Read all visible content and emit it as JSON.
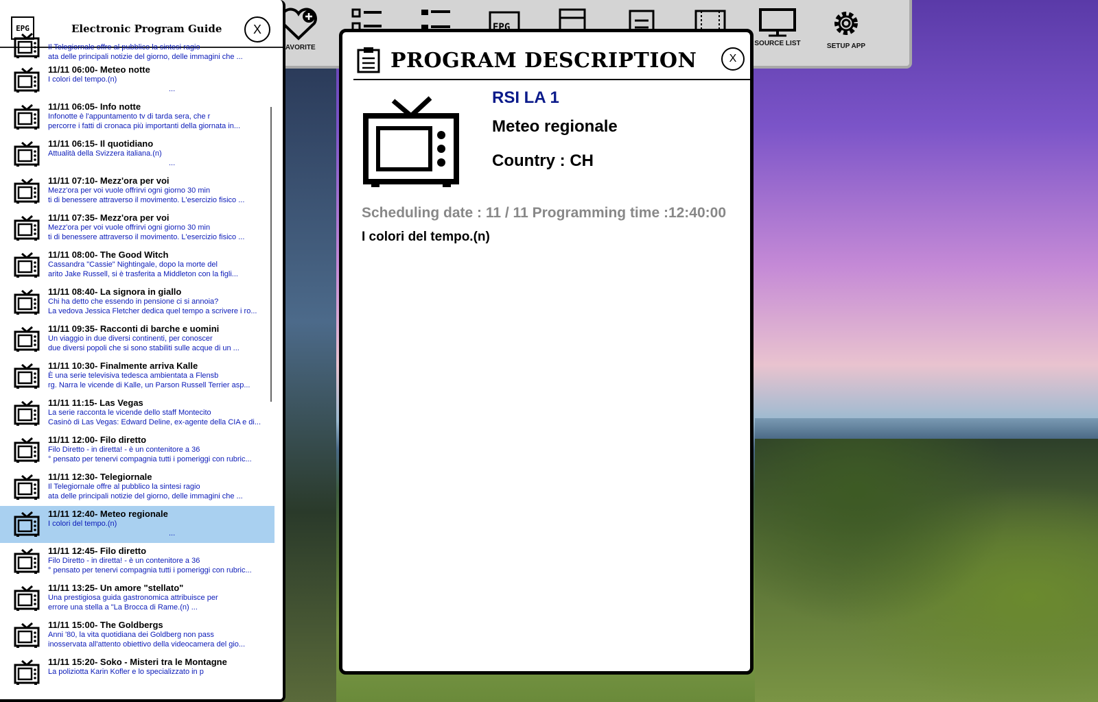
{
  "toolbar": {
    "items": [
      {
        "label": "FAVORITE",
        "icon": "heart-plus-icon"
      },
      {
        "label": "",
        "icon": "grid-list-icon"
      },
      {
        "label": "",
        "icon": "list-icon"
      },
      {
        "label": "",
        "icon": "epg-icon"
      },
      {
        "label": "",
        "icon": "record-icon"
      },
      {
        "label": "",
        "icon": "clipboard-icon"
      },
      {
        "label": "",
        "icon": "film-icon"
      },
      {
        "label": "SOURCE LIST",
        "icon": "monitor-icon"
      },
      {
        "label": "SETUP APP",
        "icon": "gear-icon"
      }
    ]
  },
  "epg": {
    "logo_text": "EPG",
    "title": "Electronic Program Guide",
    "close_label": "X",
    "programs": [
      {
        "title": "",
        "desc1": "Il Telegiornale offre al pubblico la sintesi ragio",
        "desc2": "ata delle principali notizie del giorno, delle immagini che ..."
      },
      {
        "title": "11/11 06:00- Meteo notte",
        "desc1": "I colori del tempo.(n)",
        "desc2": "..."
      },
      {
        "title": "11/11 06:05- Info notte",
        "desc1": "Infonotte è l'appuntamento tv di tarda sera, che r",
        "desc2": "percorre i fatti di cronaca più importanti della giornata in..."
      },
      {
        "title": "11/11 06:15- Il quotidiano",
        "desc1": "Attualità della Svizzera italiana.(n)",
        "desc2": "..."
      },
      {
        "title": "11/11 07:10- Mezz'ora per voi",
        "desc1": "Mezz'ora per voi vuole offrirvi ogni giorno 30 min",
        "desc2": "ti di benessere attraverso il movimento. L'esercizio fisico ..."
      },
      {
        "title": "11/11 07:35- Mezz'ora per voi",
        "desc1": "Mezz'ora per voi vuole offrirvi ogni giorno 30 min",
        "desc2": "ti di benessere attraverso il movimento. L'esercizio fisico ..."
      },
      {
        "title": "11/11 08:00- The Good Witch",
        "desc1": "Cassandra \"Cassie\" Nightingale, dopo la morte del",
        "desc2": "arito Jake Russell, si è trasferita a Middleton con la figli..."
      },
      {
        "title": "11/11 08:40- La signora in giallo",
        "desc1": "Chi ha detto che essendo in pensione ci si annoia?",
        "desc2": "La vedova Jessica Fletcher dedica quel tempo a scrivere i ro..."
      },
      {
        "title": "11/11 09:35- Racconti di barche e uomini",
        "desc1": "Un viaggio in due diversi continenti, per conoscer",
        "desc2": " due diversi popoli che si sono stabiliti sulle acque di un ..."
      },
      {
        "title": "11/11 10:30- Finalmente arriva Kalle",
        "desc1": "È una serie televisiva tedesca ambientata a Flensb",
        "desc2": "rg. Narra le vicende di Kalle, un Parson Russell Terrier asp..."
      },
      {
        "title": "11/11 11:15- Las Vegas",
        "desc1": "La serie racconta le vicende dello staff Montecito",
        "desc2": "Casinò di Las Vegas: Edward Deline, ex-agente della CIA e di..."
      },
      {
        "title": "11/11 12:00- Filo diretto",
        "desc1": "Filo Diretto - in diretta! - è un contenitore a 36",
        "desc2": "° pensato per tenervi compagnia tutti i pomeriggi con rubric..."
      },
      {
        "title": "11/11 12:30- Telegiornale",
        "desc1": "Il Telegiornale offre al pubblico la sintesi ragio",
        "desc2": "ata delle principali notizie del giorno, delle immagini che ..."
      },
      {
        "title": "11/11 12:40- Meteo regionale",
        "desc1": "I colori del tempo.(n)",
        "desc2": "...",
        "selected": true
      },
      {
        "title": "11/11 12:45- Filo diretto",
        "desc1": "Filo Diretto - in diretta! - è un contenitore a 36",
        "desc2": "° pensato per tenervi compagnia tutti i pomeriggi con rubric..."
      },
      {
        "title": "11/11 13:25- Un amore \"stellato\"",
        "desc1": "Una prestigiosa guida gastronomica attribuisce per",
        "desc2": "errore una stella a \"La Brocca di Rame.(n)                ..."
      },
      {
        "title": "11/11 15:00- The Goldbergs",
        "desc1": "Anni '80, la vita quotidiana dei Goldberg non pass",
        "desc2": " inosservata all'attento obiettivo della videocamera del gio..."
      },
      {
        "title": "11/11 15:20- Soko - Misteri tra le Montagne",
        "desc1": "La poliziotta Karin Kofler e lo specializzato in p",
        "desc2": ""
      }
    ]
  },
  "description": {
    "title": "PROGRAM DESCRIPTION",
    "close_label": "X",
    "channel": "RSI LA 1",
    "program": "Meteo regionale",
    "country": "Country : CH",
    "schedule": "Scheduling date : 11 / 11 Programming time :12:40:00",
    "text": "I colori del tempo.(n)"
  }
}
